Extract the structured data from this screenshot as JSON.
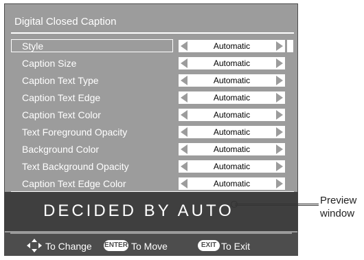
{
  "window": {
    "title": "Digital Closed Caption"
  },
  "menu": {
    "items": [
      {
        "label": "Style",
        "value": "Automatic",
        "selected": true
      },
      {
        "label": "Caption Size",
        "value": "Automatic"
      },
      {
        "label": "Caption Text Type",
        "value": "Automatic"
      },
      {
        "label": "Caption Text Edge",
        "value": "Automatic"
      },
      {
        "label": "Caption Text Color",
        "value": "Automatic"
      },
      {
        "label": "Text Foreground Opacity",
        "value": "Automatic"
      },
      {
        "label": "Background Color",
        "value": "Automatic"
      },
      {
        "label": "Text Background Opacity",
        "value": "Automatic"
      },
      {
        "label": "Caption Text Edge Color",
        "value": "Automatic"
      }
    ]
  },
  "preview": {
    "text": "DECIDED BY AUTO"
  },
  "footer": {
    "change_label": "To Change",
    "enter_key": "ENTER",
    "move_label": "To Move",
    "exit_key": "EXIT",
    "exit_label": "To Exit"
  },
  "callout": {
    "line1": "Preview",
    "line2": "window"
  },
  "colors": {
    "panel": "#9c9c9c",
    "preview_bg": "#3f3f3f",
    "footer_bg": "#4d4d4d",
    "value_bg": "#ffffff"
  }
}
